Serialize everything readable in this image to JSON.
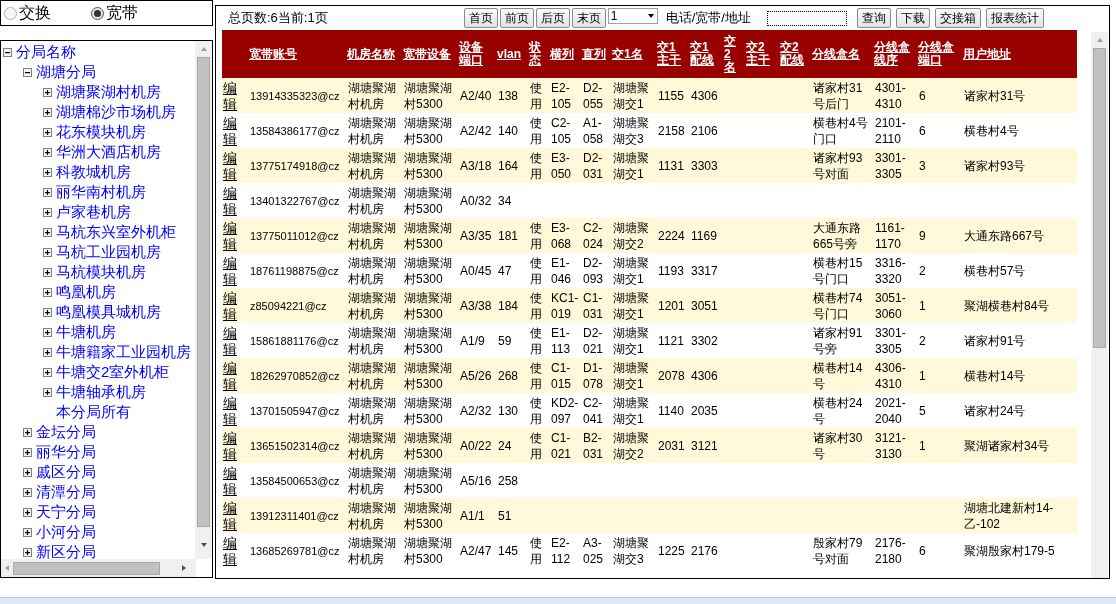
{
  "mode": {
    "options": [
      {
        "label": "交换",
        "selected": false
      },
      {
        "label": "宽带",
        "selected": true
      }
    ]
  },
  "tree": {
    "label": "分局名称",
    "expanded": true,
    "children": [
      {
        "label": "湖塘分局",
        "kind": "branch",
        "expanded": true,
        "children": [
          {
            "label": "湖塘聚湖村机房",
            "kind": "branch",
            "expanded": false
          },
          {
            "label": "湖塘棉沙市场机房",
            "kind": "branch",
            "expanded": false
          },
          {
            "label": "花东模块机房",
            "kind": "branch",
            "expanded": false
          },
          {
            "label": "华洲大酒店机房",
            "kind": "branch",
            "expanded": false
          },
          {
            "label": "科教城机房",
            "kind": "branch",
            "expanded": false
          },
          {
            "label": "丽华南村机房",
            "kind": "branch",
            "expanded": false
          },
          {
            "label": "卢家巷机房",
            "kind": "branch",
            "expanded": false
          },
          {
            "label": "马杭东兴室外机柜",
            "kind": "branch",
            "expanded": false
          },
          {
            "label": "马杭工业园机房",
            "kind": "branch",
            "expanded": false
          },
          {
            "label": "马杭模块机房",
            "kind": "branch",
            "expanded": false
          },
          {
            "label": "鸣凰机房",
            "kind": "branch",
            "expanded": false
          },
          {
            "label": "鸣凰模具城机房",
            "kind": "branch",
            "expanded": false
          },
          {
            "label": "牛塘机房",
            "kind": "branch",
            "expanded": false
          },
          {
            "label": "牛塘籍家工业园机房",
            "kind": "branch",
            "expanded": false
          },
          {
            "label": "牛塘交2室外机柜",
            "kind": "branch",
            "expanded": false
          },
          {
            "label": "牛塘轴承机房",
            "kind": "branch",
            "expanded": false
          },
          {
            "label": "本分局所有",
            "kind": "leaf"
          }
        ]
      },
      {
        "label": "金坛分局",
        "kind": "branch",
        "expanded": false
      },
      {
        "label": "丽华分局",
        "kind": "branch",
        "expanded": false
      },
      {
        "label": "戚区分局",
        "kind": "branch",
        "expanded": false
      },
      {
        "label": "清潭分局",
        "kind": "branch",
        "expanded": false
      },
      {
        "label": "天宁分局",
        "kind": "branch",
        "expanded": false
      },
      {
        "label": "小河分局",
        "kind": "branch",
        "expanded": false
      },
      {
        "label": "新区分局",
        "kind": "branch",
        "expanded": false
      }
    ]
  },
  "toolbar": {
    "page_info": "总页数:6当前:1页",
    "nav_buttons": [
      "首页",
      "前页",
      "后页",
      "末页"
    ],
    "page_select": "1",
    "search_label": "电话/宽带/地址",
    "action_buttons": [
      "查询",
      "下载",
      "交接箱",
      "报表统计"
    ]
  },
  "table": {
    "columns": [
      "宽带账号",
      "机房名称",
      "宽带设备",
      "设备端口",
      "vlan",
      "状态",
      "横列",
      "直列",
      "交1名",
      "交1主干",
      "交1配线",
      "交2名",
      "交2主干",
      "交2配线",
      "分线盒名",
      "分线盒线序",
      "分线盒端口",
      "用户地址"
    ],
    "rows": [
      {
        "edit": "编辑",
        "cells": [
          "13914335323@cz",
          "湖塘聚湖村机房",
          "湖塘聚湖村5300",
          "A2/40",
          "138",
          "使用",
          "E2-105",
          "D2-055",
          "湖塘聚湖交1",
          "1155",
          "4306",
          null,
          null,
          null,
          "诸家村31号后门",
          "4301-4310",
          "6",
          "诸家村31号"
        ]
      },
      {
        "edit": "编辑",
        "cells": [
          "13584386177@cz",
          "湖塘聚湖村机房",
          "湖塘聚湖村5300",
          "A2/42",
          "140",
          "使用",
          "C2-105",
          "A1-058",
          "湖塘聚湖交3",
          "2158",
          "2106",
          null,
          null,
          null,
          "横巷村4号门口",
          "2101-2110",
          "6",
          "横巷村4号"
        ]
      },
      {
        "edit": "编辑",
        "cells": [
          "13775174918@cz",
          "湖塘聚湖村机房",
          "湖塘聚湖村5300",
          "A3/18",
          "164",
          "使用",
          "E3-050",
          "D2-031",
          "湖塘聚湖交1",
          "1131",
          "3303",
          null,
          null,
          null,
          "诸家村93号对面",
          "3301-3305",
          "3",
          "诸家村93号"
        ]
      },
      {
        "edit": "编辑",
        "cells": [
          "13401322767@cz",
          "湖塘聚湖村机房",
          "湖塘聚湖村5300",
          "A0/32",
          "34",
          null,
          null,
          null,
          null,
          null,
          null,
          null,
          null,
          null,
          null,
          null,
          null,
          null
        ]
      },
      {
        "edit": "编辑",
        "cells": [
          "13775011012@cz",
          "湖塘聚湖村机房",
          "湖塘聚湖村5300",
          "A3/35",
          "181",
          "使用",
          "E3-068",
          "C2-024",
          "湖塘聚湖交2",
          "2224",
          "1169",
          null,
          null,
          null,
          "大通东路665号旁",
          "1161-1170",
          "9",
          "大通东路667号"
        ]
      },
      {
        "edit": "编辑",
        "cells": [
          "18761198875@cz",
          "湖塘聚湖村机房",
          "湖塘聚湖村5300",
          "A0/45",
          "47",
          "使用",
          "E1-046",
          "D2-093",
          "湖塘聚湖交1",
          "1193",
          "3317",
          null,
          null,
          null,
          "横巷村15号门口",
          "3316-3320",
          "2",
          "横巷村57号"
        ]
      },
      {
        "edit": "编辑",
        "cells": [
          "z85094221@cz",
          "湖塘聚湖村机房",
          "湖塘聚湖村5300",
          "A3/38",
          "184",
          "使用",
          "KC1-019",
          "C1-031",
          "湖塘聚湖交1",
          "1201",
          "3051",
          null,
          null,
          null,
          "横巷村74号门口",
          "3051-3060",
          "1",
          "聚湖横巷村84号"
        ]
      },
      {
        "edit": "编辑",
        "cells": [
          "15861881176@cz",
          "湖塘聚湖村机房",
          "湖塘聚湖村5300",
          "A1/9",
          "59",
          "使用",
          "E1-113",
          "D2-021",
          "湖塘聚湖交1",
          "1121",
          "3302",
          null,
          null,
          null,
          "诸家村91号旁",
          "3301-3305",
          "2",
          "诸家村91号"
        ]
      },
      {
        "edit": "编辑",
        "cells": [
          "18262970852@cz",
          "湖塘聚湖村机房",
          "湖塘聚湖村5300",
          "A5/26",
          "268",
          "使用",
          "C1-015",
          "D1-078",
          "湖塘聚湖交1",
          "2078",
          "4306",
          null,
          null,
          null,
          "横巷村14号",
          "4306-4310",
          "1",
          "横巷村14号"
        ]
      },
      {
        "edit": "编辑",
        "cells": [
          "13701505947@cz",
          "湖塘聚湖村机房",
          "湖塘聚湖村5300",
          "A2/32",
          "130",
          "使用",
          "KD2-097",
          "C2-041",
          "湖塘聚湖交1",
          "1140",
          "2035",
          null,
          null,
          null,
          "横巷村24号",
          "2021-2040",
          "5",
          "诸家村24号"
        ]
      },
      {
        "edit": "编辑",
        "cells": [
          "13651502314@cz",
          "湖塘聚湖村机房",
          "湖塘聚湖村5300",
          "A0/22",
          "24",
          "使用",
          "C1-021",
          "B2-031",
          "湖塘聚湖交2",
          "2031",
          "3121",
          null,
          null,
          null,
          "诸家村30号",
          "3121-3130",
          "1",
          "聚湖诸家村34号"
        ]
      },
      {
        "edit": "编辑",
        "cells": [
          "13584500653@cz",
          "湖塘聚湖村机房",
          "湖塘聚湖村5300",
          "A5/16",
          "258",
          null,
          null,
          null,
          null,
          null,
          null,
          null,
          null,
          null,
          null,
          null,
          null,
          null
        ]
      },
      {
        "edit": "编辑",
        "cells": [
          "13912311401@cz",
          "湖塘聚湖村机房",
          "湖塘聚湖村5300",
          "A1/1",
          "51",
          null,
          null,
          null,
          null,
          null,
          null,
          null,
          null,
          null,
          null,
          null,
          null,
          "湖塘北建新村14-乙-102"
        ]
      },
      {
        "edit": "编辑",
        "cells": [
          "13685269781@cz",
          "湖塘聚湖村机房",
          "湖塘聚湖村5300",
          "A2/47",
          "145",
          "使用",
          "E2-112",
          "A3-025",
          "湖塘聚湖交3",
          "1225",
          "2176",
          null,
          null,
          null,
          "殷家村79号对面",
          "2176-2180",
          "6",
          "聚湖殷家村179-5"
        ]
      }
    ]
  }
}
